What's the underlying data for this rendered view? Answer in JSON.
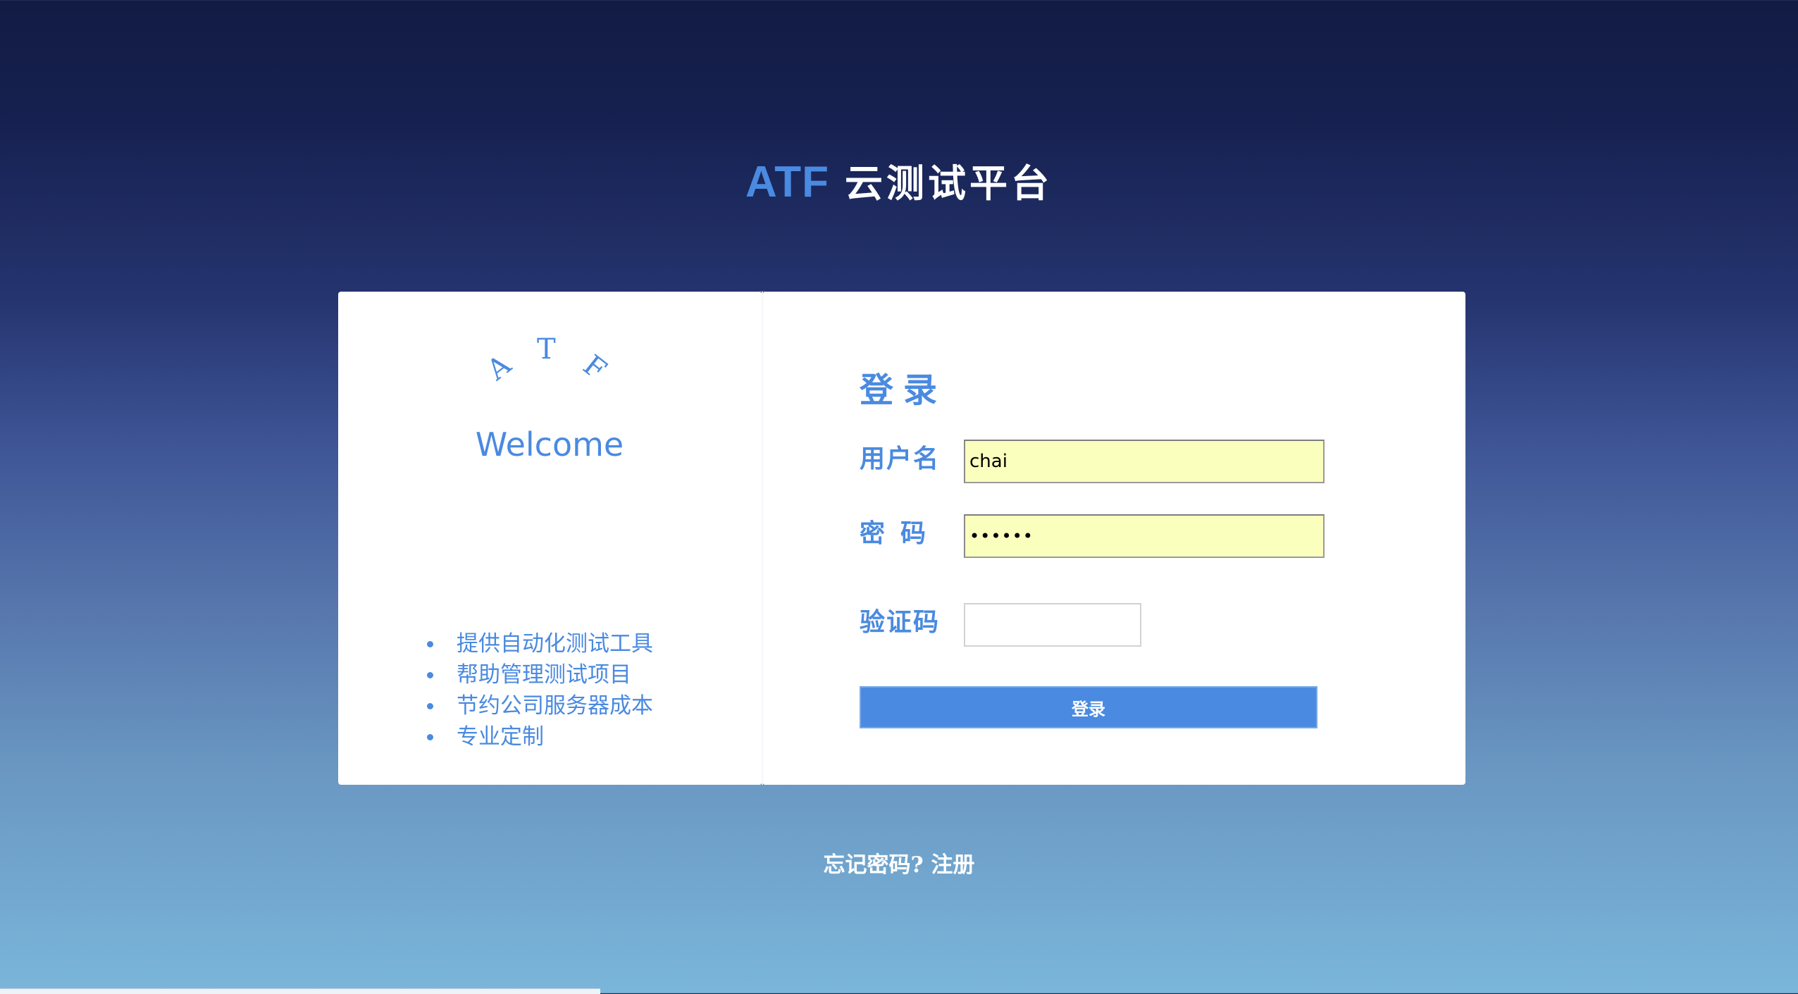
{
  "header": {
    "brand": "ATF",
    "title": "云测试平台"
  },
  "intro": {
    "logo_letters": [
      "A",
      "T",
      "F"
    ],
    "welcome": "Welcome",
    "features": [
      "提供自动化测试工具",
      "帮助管理测试项目",
      "节约公司服务器成本",
      "专业定制"
    ]
  },
  "login": {
    "heading": "登录",
    "username_label": "用户名",
    "username_value": "chai",
    "password_label": "密码",
    "password_value": "••••••",
    "captcha_label": "验证码",
    "captcha_value": "",
    "submit_label": "登录"
  },
  "footer": {
    "forgot_link": "忘记密码?",
    "register_link": "注册"
  },
  "colors": {
    "accent": "#4a8ae0",
    "autofill_bg": "#faffbd",
    "background_top": "#121b42",
    "background_bottom": "#7ab6da"
  }
}
